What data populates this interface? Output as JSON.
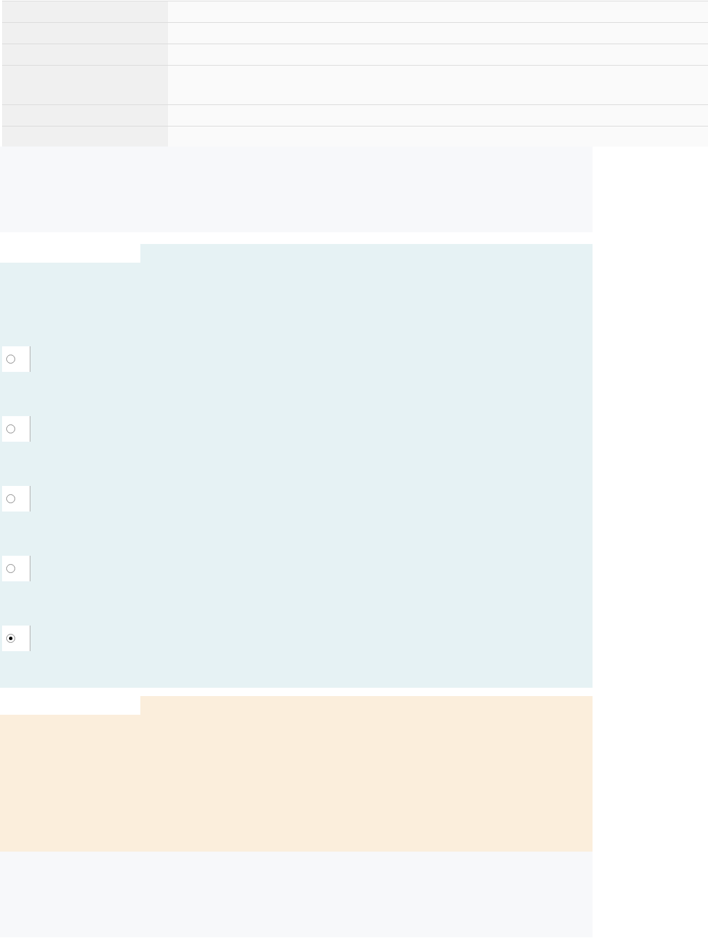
{
  "table": {
    "rows": [
      {
        "kind": "single"
      },
      {
        "kind": "single"
      },
      {
        "kind": "single"
      },
      {
        "kind": "double"
      },
      {
        "kind": "single"
      },
      {
        "kind": "single"
      }
    ]
  },
  "sections": [
    {
      "kind": "plain"
    },
    {
      "kind": "question",
      "options": [
        {
          "selected": false
        },
        {
          "selected": false
        },
        {
          "selected": false
        },
        {
          "selected": false
        },
        {
          "selected": true
        }
      ]
    },
    {
      "kind": "note"
    },
    {
      "kind": "plain"
    }
  ]
}
